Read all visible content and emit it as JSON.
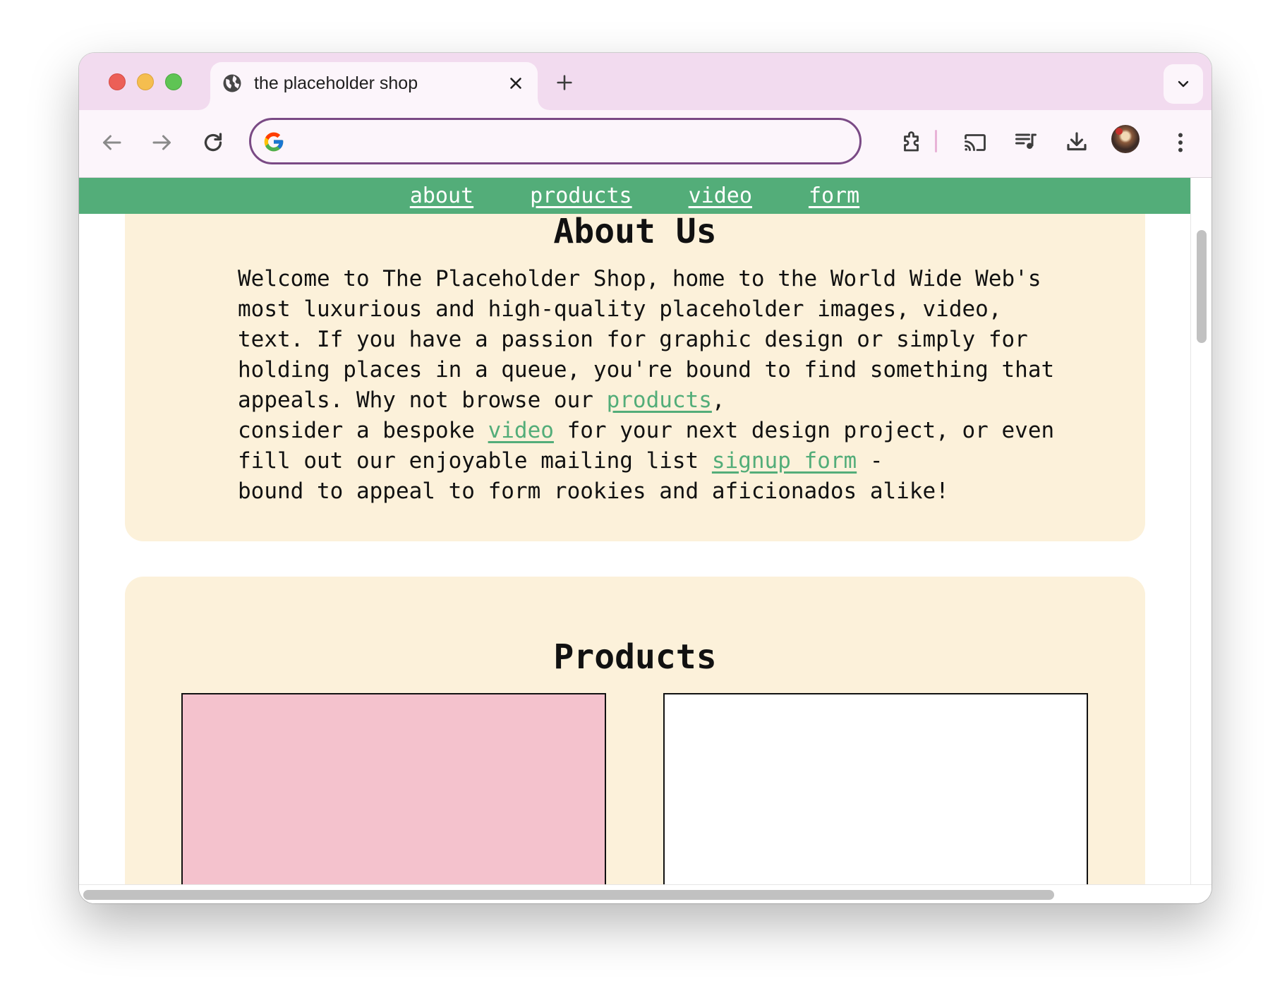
{
  "browser": {
    "tab_title": "the placeholder shop",
    "omnibox_value": "",
    "accent_color": "#7a4a85",
    "tabstrip_color": "#f2dbef"
  },
  "icons": {
    "back": "arrow-left-icon",
    "forward": "arrow-right-icon",
    "reload": "reload-icon",
    "extensions": "puzzle-piece-icon",
    "cast": "cast-icon",
    "media": "media-queue-icon",
    "downloads": "download-icon",
    "menu": "three-dot-menu-icon"
  },
  "nav": {
    "background": "#53ad79",
    "links": [
      "about",
      "products",
      "video",
      "form"
    ]
  },
  "about": {
    "title": "About Us",
    "text_before_products": "Welcome to The Placeholder Shop, home to the World Wide Web's most luxurious and high-quality placeholder images, video, text. If you have a passion for graphic design or simply for holding places in a queue, you're bound to find something that appeals. Why not browse our ",
    "link_products": "products",
    "text_before_video": ",\nconsider a bespoke ",
    "link_video": "video",
    "text_before_form": " for your next design project, or even fill out our enjoyable mailing list ",
    "link_form": "signup form",
    "text_after_form": " -\nbound to appeal to form rookies and aficionados alike!"
  },
  "products": {
    "title": "Products",
    "items": [
      {
        "color": "#f4c2cd"
      },
      {
        "color": "#ffffff"
      }
    ]
  },
  "card_color": "#fcf1da"
}
